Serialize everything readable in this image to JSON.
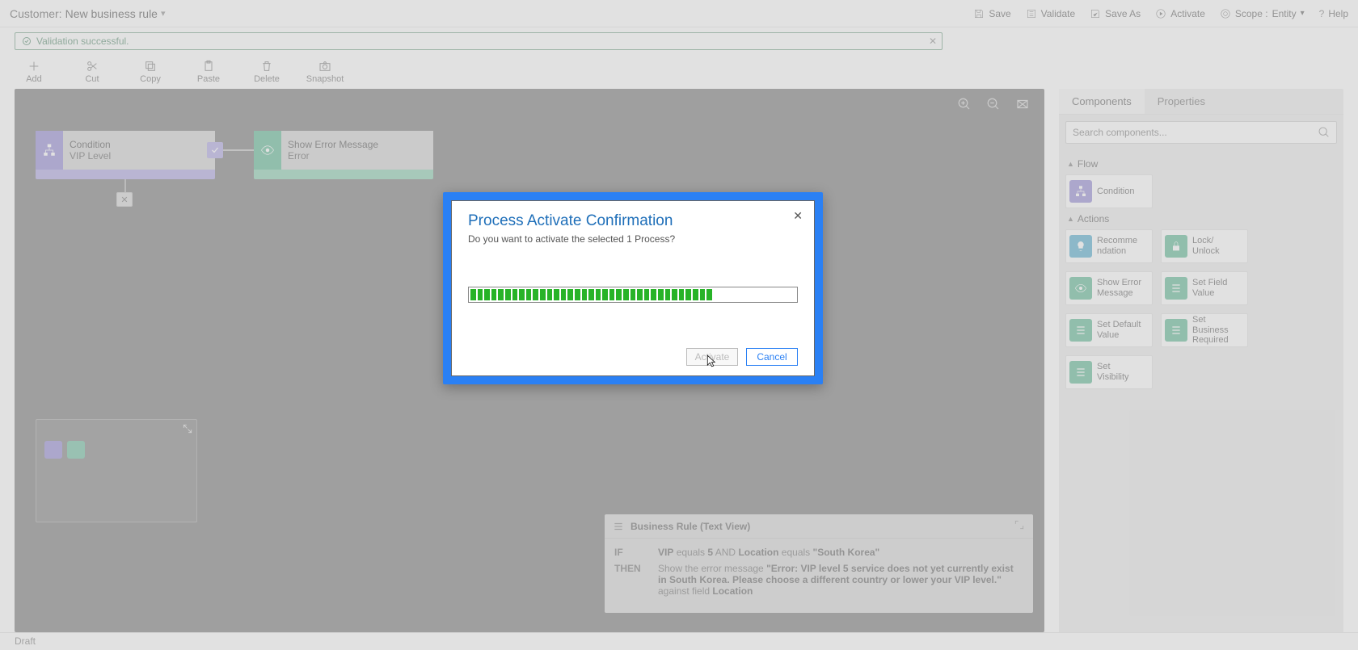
{
  "header": {
    "title_label": "Customer:",
    "title_name": "New business rule",
    "actions": {
      "save": "Save",
      "validate": "Validate",
      "save_as": "Save As",
      "activate": "Activate",
      "scope_label": "Scope :",
      "scope_value": "Entity",
      "help": "Help"
    }
  },
  "validation": {
    "message": "Validation successful."
  },
  "toolbar": {
    "add": "Add",
    "cut": "Cut",
    "copy": "Copy",
    "paste": "Paste",
    "delete": "Delete",
    "snapshot": "Snapshot"
  },
  "canvas": {
    "condition": {
      "title": "Condition",
      "subtitle": "VIP Level"
    },
    "error_node": {
      "title": "Show Error Message",
      "subtitle": "Error"
    }
  },
  "textview": {
    "title": "Business Rule (Text View)",
    "if_label": "IF",
    "then_label": "THEN",
    "if_line_pre": "",
    "if_vip": "VIP",
    "if_eq1": "equals",
    "if_five": "5",
    "if_and": "AND",
    "if_loc": "Location",
    "if_eq2": "equals",
    "if_val": "\"South Korea\"",
    "then_pre": "Show the error message",
    "then_msg": "\"Error: VIP level 5 service does not yet currently exist in South Korea. Please choose a different country or lower your VIP level.\"",
    "then_post": "against field",
    "then_field": "Location"
  },
  "right": {
    "tabs": {
      "components": "Components",
      "properties": "Properties"
    },
    "search_placeholder": "Search components...",
    "group_flow": "Flow",
    "group_actions": "Actions",
    "cards": {
      "condition": "Condition",
      "recommendation": "Recomme\nndation",
      "lock": "Lock/\nUnlock",
      "show_err": "Show Error\nMessage",
      "set_field": "Set Field\nValue",
      "set_default": "Set Default\nValue",
      "set_required": "Set\nBusiness\nRequired",
      "set_visibility": "Set\nVisibility"
    }
  },
  "footer": {
    "status": "Draft"
  },
  "modal": {
    "title": "Process Activate Confirmation",
    "subtitle": "Do you want to activate the selected 1 Process?",
    "activate": "Activate",
    "cancel": "Cancel",
    "progress_ticks": 35,
    "progress_total": 47
  }
}
